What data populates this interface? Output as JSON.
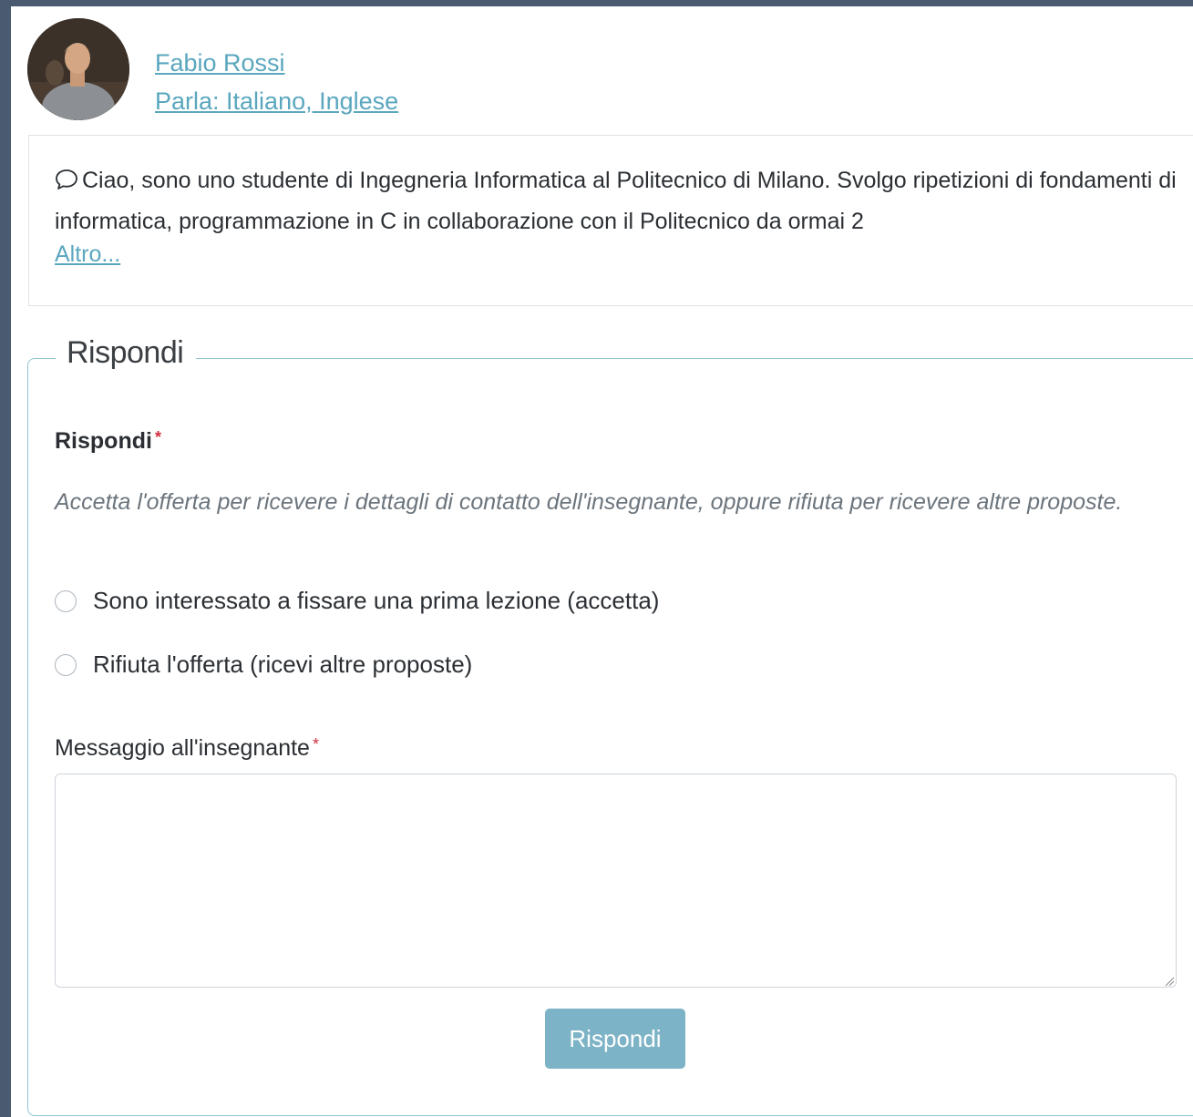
{
  "teacher": {
    "name": "Fabio Rossi",
    "languages": "Parla: Italiano, Inglese"
  },
  "bio": {
    "text": "Ciao, sono uno studente di Ingegneria Informatica al Politecnico di Milano. Svolgo ripetizioni di fondamenti di informatica, programmazione in C in collaborazione con il Politecnico da ormai 2",
    "more_link": "Altro..."
  },
  "reply_form": {
    "legend": "Rispondi",
    "reply_label": "Rispondi",
    "required_mark": "*",
    "help_text": "Accetta l'offerta per ricevere i dettagli di contatto dell'insegnante, oppure rifiuta per ricevere altre proposte.",
    "options": [
      {
        "label": "Sono interessato a fissare una prima lezione (accetta)"
      },
      {
        "label": "Rifiuta l'offerta (ricevi altre proposte)"
      }
    ],
    "message_label": "Messaggio all'insegnante",
    "message_value": "",
    "submit_label": "Rispondi"
  },
  "colors": {
    "link": "#5aa7be",
    "fieldset_border": "#8fc4d3",
    "button": "#7db3c6",
    "required": "#d0303f",
    "page_border": "#4a5a70"
  }
}
